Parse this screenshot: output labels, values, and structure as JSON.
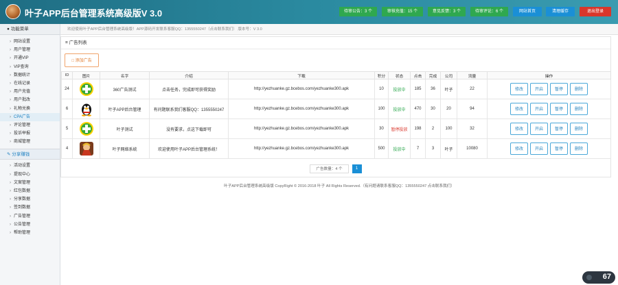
{
  "header": {
    "title": "叶子APP后台管理系统高级版V 3.0",
    "buttons": [
      {
        "label": "待审公告：3 个",
        "color": "green"
      },
      {
        "label": "审核充值：15 个",
        "color": "green"
      },
      {
        "label": "意见反馈：3 个",
        "color": "green"
      },
      {
        "label": "待审评论：6 个",
        "color": "green"
      },
      {
        "label": "网站首页",
        "color": "blue"
      },
      {
        "label": "清理缓存",
        "color": "blue"
      },
      {
        "label": "退出登录",
        "color": "red"
      }
    ]
  },
  "sidebar": {
    "header": "功能菜单",
    "items": [
      "网站设置",
      "用户管理",
      "开通VIP",
      "VIP查询",
      "数据统计",
      "在线记录",
      "用户充值",
      "用户批改",
      "礼物兑换",
      "CPA广告",
      "评论管理",
      "投诉举报",
      "商城管理"
    ],
    "active_index": 9,
    "group": "分享赚钱",
    "group_items": [
      "活动设置",
      "提现中心",
      "文案管理",
      "红包数据",
      "分享数据",
      "签到数据",
      "广告管理",
      "公告管理",
      "帮助管理"
    ]
  },
  "notice": "欢迎使用叶子APP后台管理系统高级版！APP源码开发联系客服QQ：1355550247（点击联系我们）  版本号：V 3.0",
  "panel": {
    "title": "广告列表",
    "add_button": "添加广告"
  },
  "table": {
    "columns": [
      "ID",
      "图片",
      "名字",
      "介绍",
      "下载",
      "积分",
      "状态",
      "点击",
      "完成",
      "公司",
      "流量",
      "操作"
    ],
    "rows": [
      {
        "id": "24",
        "icon": "green-plus-icon",
        "name": "360广告测试",
        "intro": "点击任务，完成即可获得奖励",
        "url": "http://yezhuanke.gz.bcebos.com/yezhuanke300.apk",
        "points": "10",
        "status": "投放中",
        "status_type": "on",
        "clicks": "185",
        "done": "36",
        "company": "叶子",
        "flow": "22",
        "ops": [
          "修改",
          "开启",
          "暂停",
          "删除"
        ]
      },
      {
        "id": "6",
        "icon": "qq-penguin-icon",
        "name": "叶子APP后台管理",
        "intro": "有问题联系我们客服QQ：1355550247",
        "url": "http://yezhuanke.gz.bcebos.com/yezhuanke300.apk",
        "points": "100",
        "status": "投放中",
        "status_type": "on",
        "clicks": "470",
        "done": "30",
        "company": "20",
        "flow": "94",
        "ops": [
          "修改",
          "开启",
          "暂停",
          "删除"
        ]
      },
      {
        "id": "5",
        "icon": "green-plus-icon",
        "name": "叶子测试",
        "intro": "没有要求，点这下载即可",
        "url": "http://yezhuanke.gz.bcebos.com/yezhuanke300.apk",
        "points": "30",
        "status": "暂停投放",
        "status_type": "off",
        "clicks": "198",
        "done": "2",
        "company": "100",
        "flow": "32",
        "ops": [
          "修改",
          "开启",
          "暂停",
          "删除"
        ]
      },
      {
        "id": "4",
        "icon": "game-character-icon",
        "name": "叶子网络系统",
        "intro": "欢迎使用叶子APP后台管理系统！",
        "url": "http://yezhuanke.gz.bcebos.com/yezhuanke300.apk",
        "points": "500",
        "status": "投放中",
        "status_type": "on",
        "clicks": "7",
        "done": "3",
        "company": "叶子",
        "flow": "10080",
        "ops": [
          "修改",
          "开启",
          "暂停",
          "删除"
        ]
      }
    ]
  },
  "pager": {
    "info": "广告数量：4 个",
    "current": "1"
  },
  "footer": "叶子APP后台管理系统高级版 CopyRight © 2016-2018 叶子 All Rights Reserved.（有问题请联系客服QQ：1355550247 点击联系我们）",
  "overlay": {
    "value": "67"
  },
  "colors": {
    "header": "#2a8aa0",
    "green": "#2fa84f",
    "blue": "#1a8fd6",
    "red": "#d9362b"
  }
}
